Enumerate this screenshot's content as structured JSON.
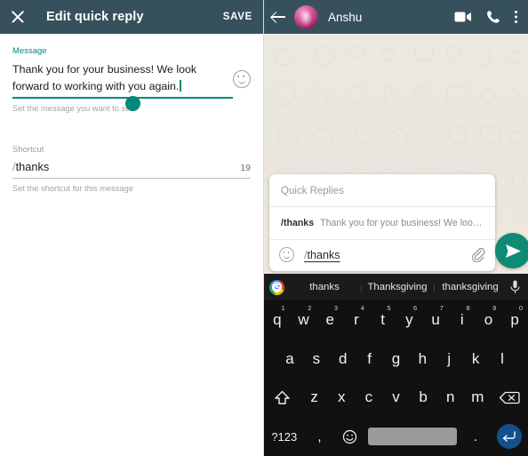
{
  "left_panel": {
    "header": {
      "close_icon": "close-icon",
      "title": "Edit quick reply",
      "save_label": "SAVE"
    },
    "message_field": {
      "label": "Message",
      "value": "Thank you for your business! We look forward to working with you again.",
      "helper": "Set the message you want to se",
      "emoji_icon": "emoji-smiley-icon"
    },
    "shortcut_field": {
      "label": "Shortcut",
      "slash": "/",
      "value": "thanks",
      "char_count": "19",
      "helper": "Set the shortcut for this message"
    }
  },
  "right_panel": {
    "header": {
      "back_icon": "back-arrow-icon",
      "avatar": "contact-avatar",
      "contact_name": "Anshu",
      "video_icon": "video-call-icon",
      "call_icon": "phone-call-icon",
      "menu_icon": "overflow-menu-icon"
    },
    "quick_replies": {
      "title": "Quick Replies",
      "items": [
        {
          "shortcut": "/thanks",
          "preview": "Thank you for your business! We look for…"
        }
      ],
      "input": {
        "slash": "/",
        "value": "thanks",
        "emoji_icon": "emoji-smiley-icon",
        "attach_icon": "paperclip-icon"
      },
      "send_icon": "send-icon"
    }
  },
  "keyboard": {
    "suggestions": {
      "logo": "google-logo-icon",
      "logo_letter": "G",
      "items": [
        "thanks",
        "Thanksgiving",
        "thanksgiving"
      ],
      "mic_icon": "microphone-icon"
    },
    "row1": [
      {
        "key": "q",
        "num": "1"
      },
      {
        "key": "w",
        "num": "2"
      },
      {
        "key": "e",
        "num": "3"
      },
      {
        "key": "r",
        "num": "4"
      },
      {
        "key": "t",
        "num": "5"
      },
      {
        "key": "y",
        "num": "6"
      },
      {
        "key": "u",
        "num": "7"
      },
      {
        "key": "i",
        "num": "8"
      },
      {
        "key": "o",
        "num": "9"
      },
      {
        "key": "p",
        "num": "0"
      }
    ],
    "row2": [
      "a",
      "s",
      "d",
      "f",
      "g",
      "h",
      "j",
      "k",
      "l"
    ],
    "row3": {
      "shift_icon": "shift-key-icon",
      "keys": [
        "z",
        "x",
        "c",
        "v",
        "b",
        "n",
        "m"
      ],
      "backspace_icon": "backspace-key-icon"
    },
    "row4": {
      "symbols_label": "?123",
      "comma": ",",
      "emoji_icon": "emoji-key-icon",
      "space_label": "",
      "period": ".",
      "enter_icon": "enter-key-icon"
    }
  },
  "colors": {
    "header_bg": "#37515c",
    "accent_teal": "#00897b",
    "send_green": "#0e8a75",
    "enter_blue": "#12518b",
    "chat_bg": "#ece5dd",
    "keyboard_bg": "#111111"
  }
}
